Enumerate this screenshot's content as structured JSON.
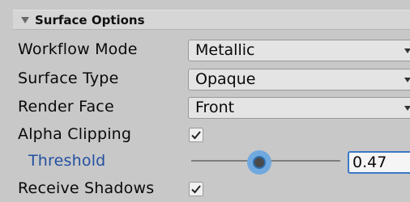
{
  "section": {
    "title": "Surface Options",
    "expanded": true
  },
  "fields": {
    "workflow_mode": {
      "label": "Workflow Mode",
      "value": "Metallic"
    },
    "surface_type": {
      "label": "Surface Type",
      "value": "Opaque"
    },
    "render_face": {
      "label": "Render Face",
      "value": "Front"
    },
    "alpha_clipping": {
      "label": "Alpha Clipping",
      "checked": true
    },
    "threshold": {
      "label": "Threshold",
      "value": "0.47",
      "slider_fraction": 0.47
    },
    "receive_shadows": {
      "label": "Receive Shadows",
      "checked": true
    }
  },
  "colors": {
    "panel_bg": "#c8c8c8",
    "header_bg": "#d6d6d6",
    "accent": "#3b78c8",
    "indented_label": "#2250a0"
  }
}
